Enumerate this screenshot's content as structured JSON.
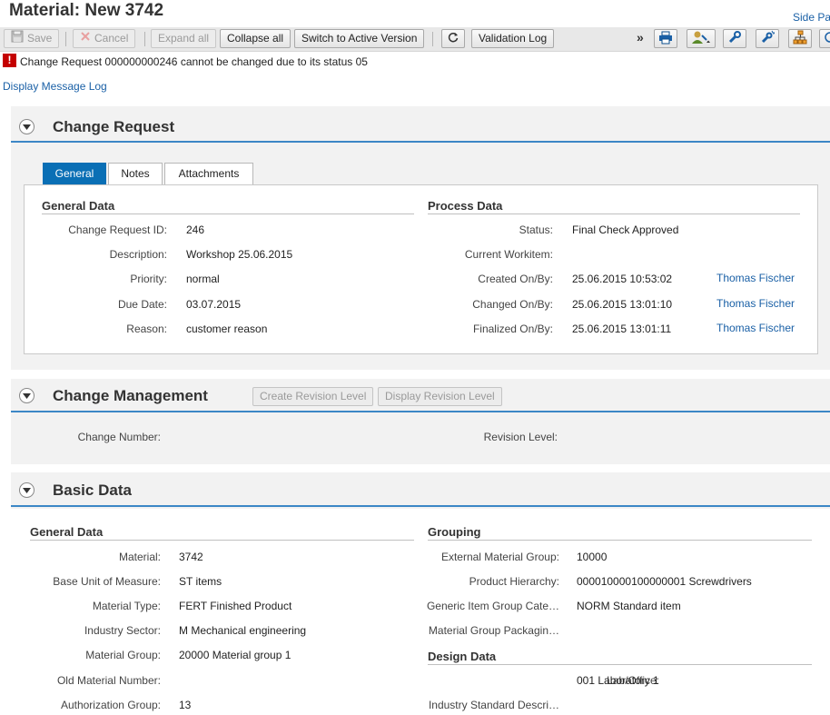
{
  "window": {
    "title": "Material: New 3742",
    "side_panel_label": "Side Pa"
  },
  "toolbar": {
    "save": "Save",
    "cancel": "Cancel",
    "expand_all": "Expand all",
    "collapse_all": "Collapse all",
    "switch_active": "Switch to Active Version",
    "validation_log": "Validation Log",
    "overflow": "»"
  },
  "messages": {
    "error_text": "Change Request 000000000246 cannot be changed due to its status 05",
    "display_log": "Display Message Log"
  },
  "change_request": {
    "title": "Change Request",
    "tabs": [
      {
        "label": "General",
        "active": true
      },
      {
        "label": "Notes",
        "active": false
      },
      {
        "label": "Attachments",
        "active": false
      }
    ],
    "general_data": {
      "title": "General Data",
      "fields": [
        {
          "label": "Change Request ID:",
          "value": "246"
        },
        {
          "label": "Description:",
          "value": "Workshop 25.06.2015"
        },
        {
          "label": "Priority:",
          "value": "normal"
        },
        {
          "label": "Due Date:",
          "value": "03.07.2015"
        },
        {
          "label": "Reason:",
          "value": "customer reason"
        }
      ]
    },
    "process_data": {
      "title": "Process Data",
      "fields": [
        {
          "label": "Status:",
          "value": "Final Check Approved",
          "user": ""
        },
        {
          "label": "Current Workitem:",
          "value": "",
          "user": ""
        },
        {
          "label": "Created On/By:",
          "value": "25.06.2015 10:53:02",
          "user": "Thomas Fischer"
        },
        {
          "label": "Changed On/By:",
          "value": "25.06.2015 13:01:10",
          "user": "Thomas Fischer"
        },
        {
          "label": "Finalized On/By:",
          "value": "25.06.2015 13:01:11",
          "user": "Thomas Fischer"
        }
      ]
    }
  },
  "change_management": {
    "title": "Change Management",
    "create_revision": "Create Revision Level",
    "display_revision": "Display Revision Level",
    "change_number_label": "Change Number:",
    "change_number_value": "",
    "revision_level_label": "Revision Level:",
    "revision_level_value": ""
  },
  "basic_data": {
    "title": "Basic Data",
    "general_data": {
      "title": "General Data",
      "fields": [
        {
          "label": "Material:",
          "value": "3742"
        },
        {
          "label": "Base Unit of Measure:",
          "value": "ST items"
        },
        {
          "label": "Material Type:",
          "value": "FERT Finished Product"
        },
        {
          "label": "Industry Sector:",
          "value": "M Mechanical engineering"
        },
        {
          "label": "Material Group:",
          "value": "20000 Material group 1"
        },
        {
          "label": "Old Material Number:",
          "value": ""
        },
        {
          "label": "Authorization Group:",
          "value": "13"
        }
      ]
    },
    "grouping": {
      "title": "Grouping",
      "fields": [
        {
          "label": "External Material Group:",
          "value": "10000"
        },
        {
          "label": "Product Hierarchy:",
          "value": "000010000100000001 Screwdrivers"
        },
        {
          "label": "Generic Item Group Cate…",
          "value": "NORM Standard item"
        },
        {
          "label": "Material Group Packagin…",
          "value": ""
        }
      ]
    },
    "design_data": {
      "title": "Design Data",
      "fields": [
        {
          "label": "Lab/Office:",
          "value": "001 Laboratory 1"
        },
        {
          "label": "Industry Standard Descri…",
          "value": ""
        }
      ]
    }
  },
  "colors": {
    "accent_blue": "#0a6fb5",
    "link_blue": "#1a60a6",
    "error_red": "#c40000",
    "panel_bg": "#f2f2f2"
  }
}
